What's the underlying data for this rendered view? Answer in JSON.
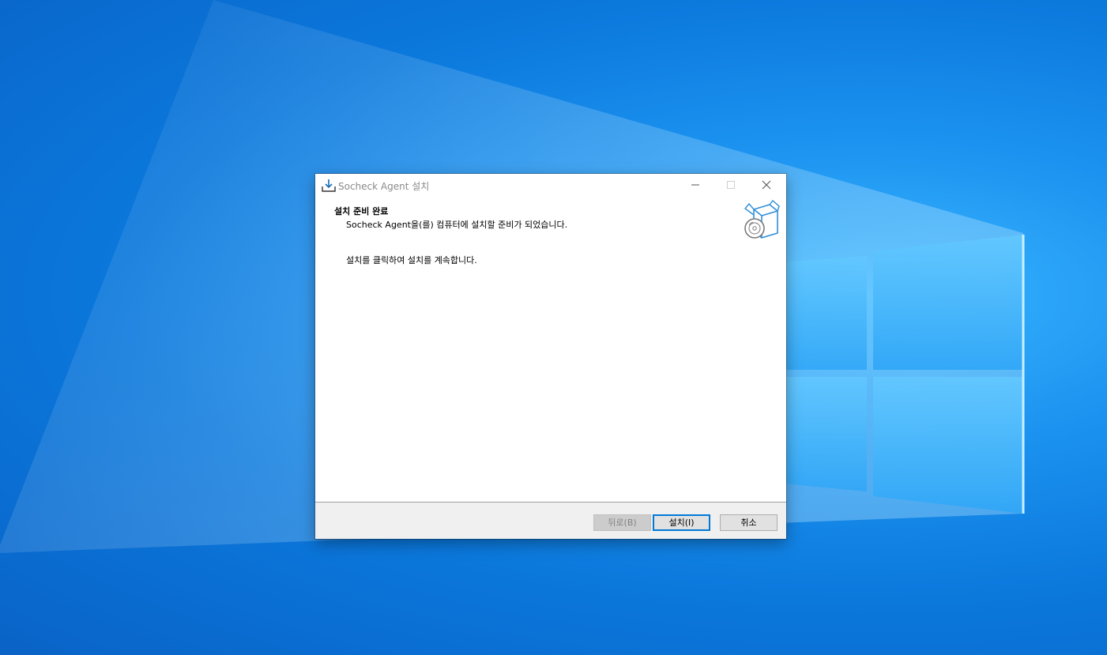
{
  "window": {
    "title": "Socheck Agent 설치",
    "app_icon": "install-download-icon"
  },
  "header": {
    "title": "설치 준비 완료",
    "subtitle": "Socheck Agent을(를) 컴퓨터에 설치할 준비가 되었습니다.",
    "art_icon": "software-box-disc-icon"
  },
  "body": {
    "instruction": "설치를 클릭하여 설치를 계속합니다."
  },
  "buttons": {
    "back": "뒤로(B)",
    "install": "설치(I)",
    "cancel": "취소"
  },
  "colors": {
    "accent": "#0078d7",
    "desktop": "#0b78dc"
  }
}
